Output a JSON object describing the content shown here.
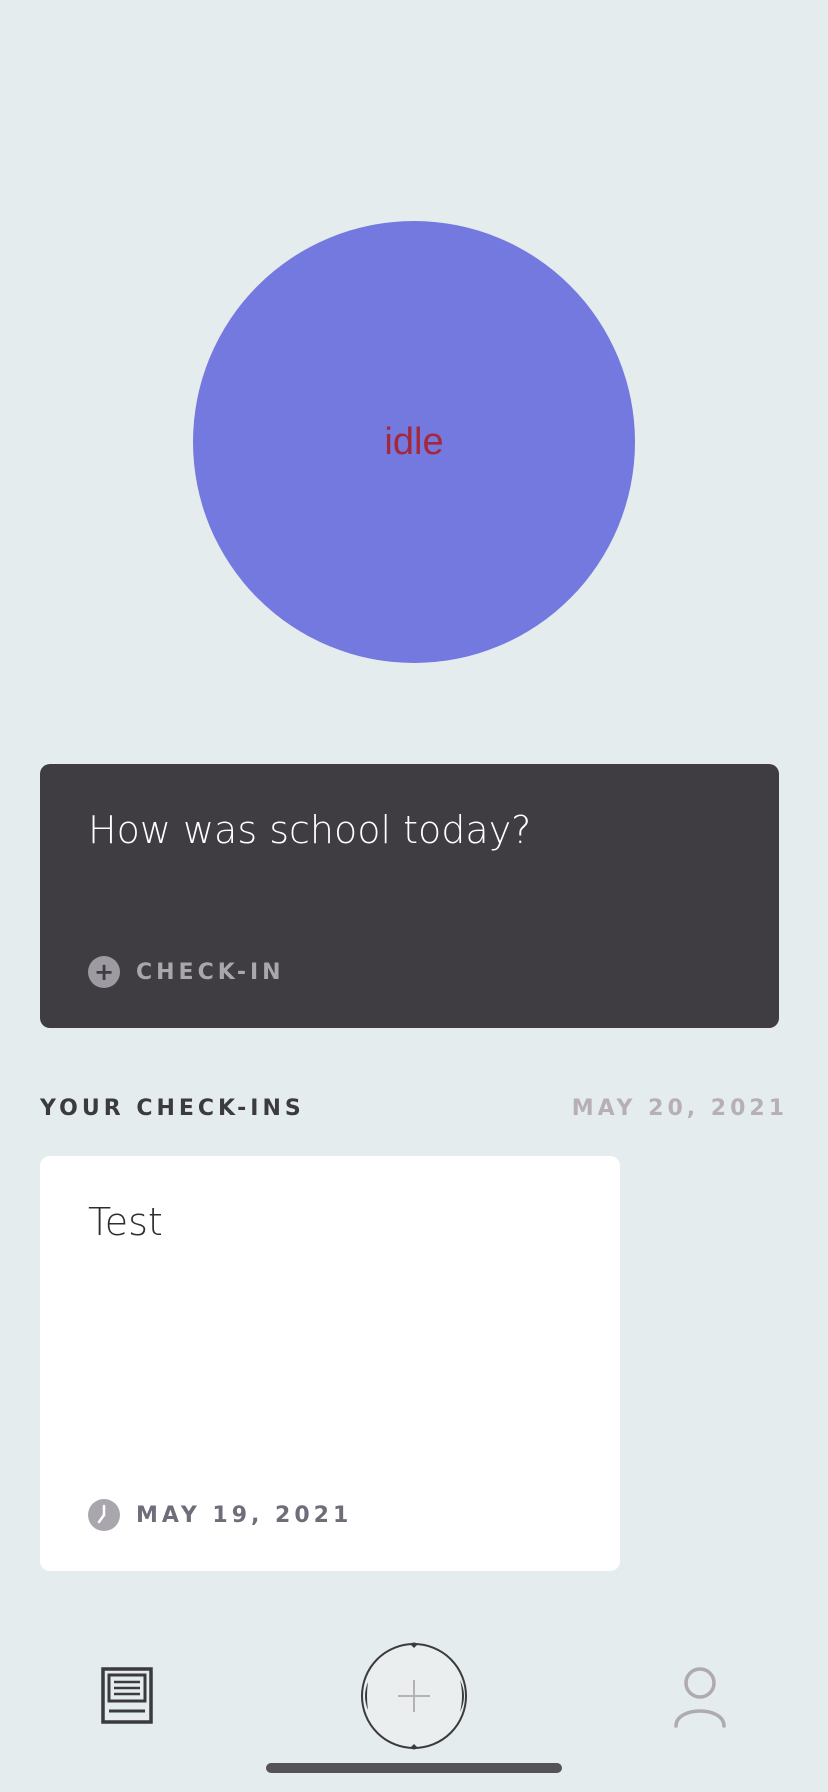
{
  "orb": {
    "label": "idle",
    "color": "#7479df",
    "label_color": "#a5283a"
  },
  "prompt_card": {
    "question": "How was school today?",
    "action_label": "CHECK-IN",
    "action_icon": "plus-circle-icon"
  },
  "checkins_section": {
    "title": "YOUR CHECK-INS",
    "date": "MAY 20, 2021"
  },
  "entries": [
    {
      "title": "Test",
      "date": "MAY 19, 2021",
      "date_icon": "clock-icon"
    }
  ],
  "tab_bar": {
    "items": [
      {
        "name": "journal",
        "icon": "journal-icon"
      },
      {
        "name": "add",
        "icon": "plus-icon"
      },
      {
        "name": "profile",
        "icon": "person-icon"
      }
    ]
  },
  "colors": {
    "background": "#e5eced",
    "card_dark": "#3f3c42",
    "card_light": "#ffffff"
  }
}
